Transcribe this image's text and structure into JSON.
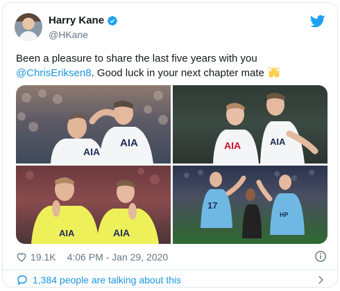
{
  "author": {
    "display_name": "Harry Kane",
    "handle": "@HKane",
    "verified": true,
    "avatar_icon": "profile-photo"
  },
  "tweet": {
    "text_line1": "Been a pleasure to share the last five years with you",
    "mention": "@ChrisEriksen8",
    "text_line2": ". Good luck in your next chapter mate",
    "emoji": "raising-hands-emoji"
  },
  "media": {
    "photos": [
      {
        "label": "photo-1",
        "shirt_text": "AIA"
      },
      {
        "label": "photo-2",
        "shirt_text": "AIA"
      },
      {
        "label": "photo-3",
        "shirt_text": "AIA"
      },
      {
        "label": "photo-4",
        "shirt_text": ""
      }
    ]
  },
  "meta": {
    "likes": "19.1K",
    "timestamp": "4:06 PM - Jan 29, 2020"
  },
  "footer": {
    "talking_text": "1,384 people are talking about this"
  },
  "colors": {
    "link": "#1b95e0",
    "secondary_text": "#657786",
    "border": "#e1e8ed",
    "twitter_blue": "#1da1f2"
  }
}
